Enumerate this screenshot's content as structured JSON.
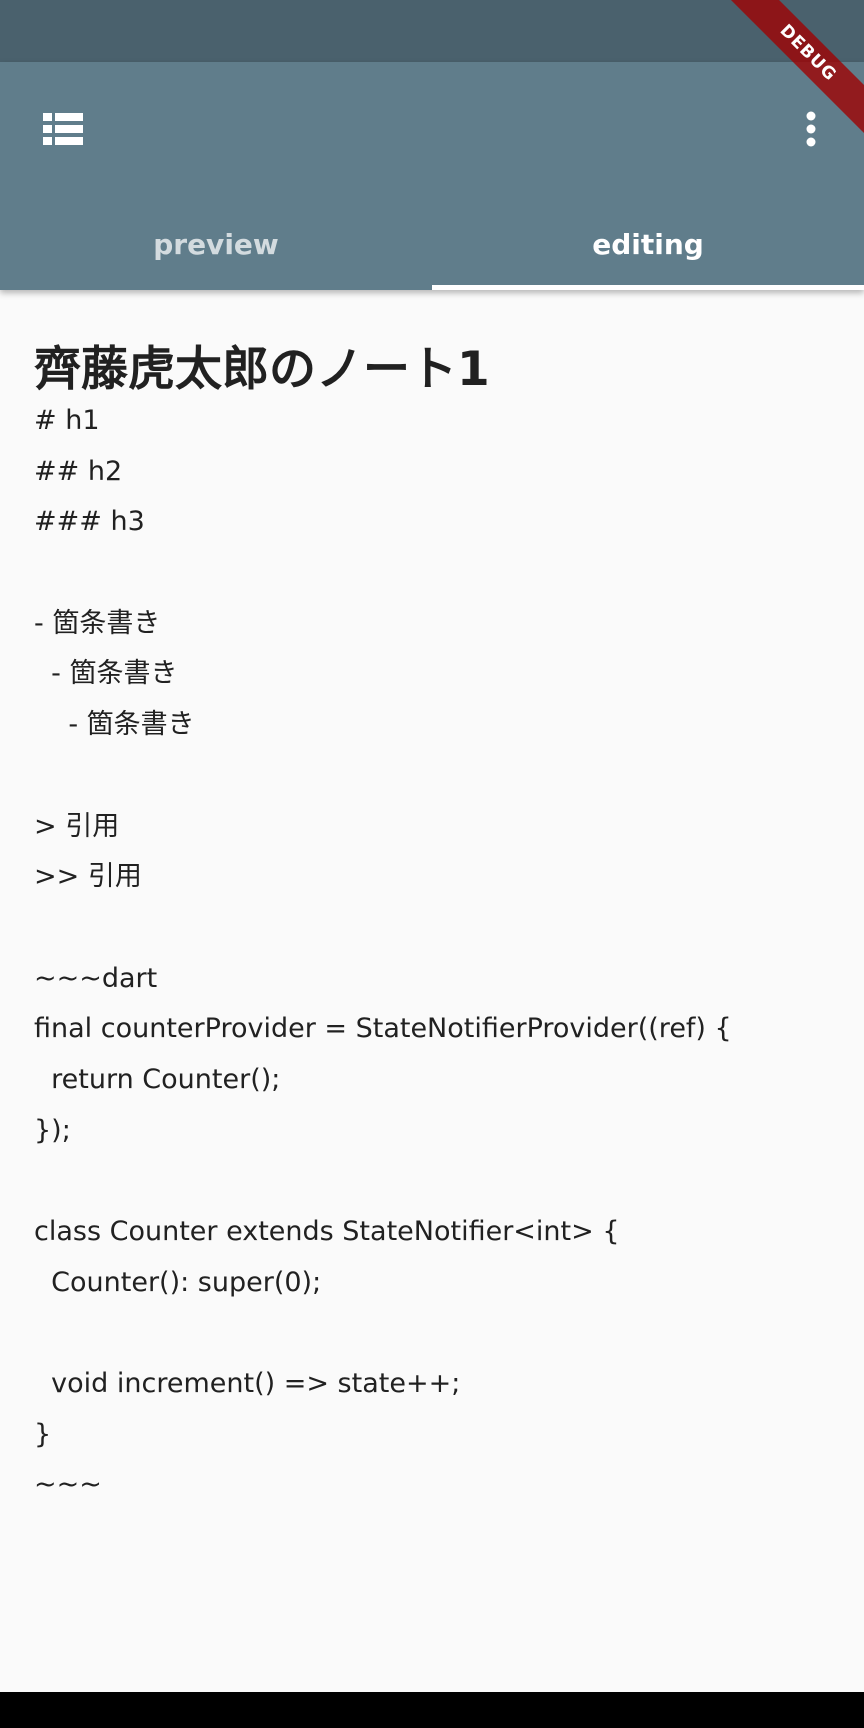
{
  "debug_banner": {
    "label": "DEBUG"
  },
  "app_bar": {
    "list_icon": "list-icon",
    "more_icon": "more-vert-icon",
    "colors": {
      "primary": "#607d8b",
      "status": "#4a616d",
      "indicator": "#ffffff"
    }
  },
  "tabs": [
    {
      "label": "preview",
      "selected": false
    },
    {
      "label": "editing",
      "selected": true
    }
  ],
  "note": {
    "title": "齊藤虎太郎のノート1",
    "lines": [
      "# h1",
      "## h2",
      "### h3",
      "",
      "- 箇条書き",
      "  - 箇条書き",
      "    - 箇条書き",
      "",
      "> 引用",
      ">> 引用",
      "",
      "~~~dart",
      "final counterProvider = StateNotifierProvider((ref) {",
      "  return Counter();",
      "});",
      "",
      "class Counter extends StateNotifier<int> {",
      "  Counter(): super(0);",
      "",
      "  void increment() => state++;",
      "}",
      "~~~"
    ]
  }
}
